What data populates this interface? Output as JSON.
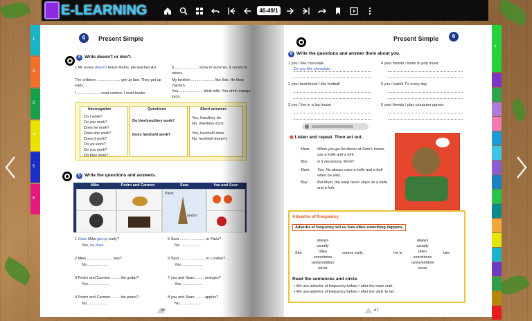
{
  "app": {
    "logo_text": "E-LEARNING",
    "page_indicator": "46-49/1"
  },
  "toolbar": {
    "icons": [
      "home-icon",
      "zoom-icon",
      "thumbnails-icon",
      "undo-icon",
      "first-page-icon",
      "prev-page-icon",
      "next-page-icon",
      "last-page-icon",
      "redo-icon",
      "bookmark-icon",
      "slideshow-icon",
      "more-icon"
    ]
  },
  "left": {
    "unit": "6",
    "title": "Present Simple",
    "ex4_num": "4",
    "ex4_title": "Write doesn't or don't.",
    "ex4_lines": [
      {
        "n": "1",
        "t": "Mr Jones ",
        "fill": "doesn't",
        "rest": " teach Maths. He teaches Art."
      },
      {
        "n": "2",
        "t": "The children ...................... get up late. They get up early.",
        "fill": "",
        "rest": ""
      },
      {
        "n": "3",
        "t": "I ...................... read comics. I read books.",
        "fill": "",
        "rest": ""
      },
      {
        "n": "4",
        "t": "It ...................... snow in summer. It snows in winter.",
        "fill": "",
        "rest": ""
      },
      {
        "n": "5",
        "t": "My brother ...................... like fish. He likes chicken.",
        "fill": "",
        "rest": ""
      },
      {
        "n": "6",
        "t": "You ...................... drink milk. You drink orange juice.",
        "fill": "",
        "rest": ""
      }
    ],
    "table": {
      "headers": [
        "Interrogative",
        "Questions",
        "Short answers"
      ],
      "interrogative": [
        "Do I work?",
        "Do you work?",
        "Does he work?",
        "Does she work?",
        "Does it work?",
        "Do we work?",
        "Do you work?",
        "Do they work?"
      ],
      "questions": [
        "Do I/we/you/they work?",
        "Does he/she/it work?"
      ],
      "answers": [
        "Yes, I/we/they do.",
        "No, I/we/they don't.",
        "Yes, he/she/it does.",
        "No, he/she/it doesn't."
      ]
    },
    "ex5_num": "5",
    "ex5_title": "Write the questions and answers.",
    "columns": [
      "Mike",
      "Pedro and Carmen",
      "Sara",
      "You and Sean"
    ],
    "places": [
      "Paris",
      "London"
    ],
    "ex5_lines": [
      {
        "n": "1",
        "a": "Does",
        "b": "Mike ",
        "c": "get up",
        "d": " early?",
        "e": "Yes, ",
        "f": "he does"
      },
      {
        "n": "2",
        "a": "",
        "b": "Mike ........................ late?",
        "c": "",
        "d": "",
        "e": "No, ..................",
        "f": ""
      },
      {
        "n": "3",
        "a": "",
        "b": "Pedro and Carmen ........ the guitar?",
        "c": "",
        "d": "",
        "e": "Yes, ..................",
        "f": ""
      },
      {
        "n": "4",
        "a": "",
        "b": "Pedro and Carmen ........ the piano?",
        "c": "",
        "d": "",
        "e": "No, ..................",
        "f": ""
      },
      {
        "n": "5",
        "a": "",
        "b": "Sara ........................ in Paris?",
        "c": "",
        "d": "",
        "e": "No, ..................",
        "f": ""
      },
      {
        "n": "6",
        "a": "",
        "b": "Sara ........................ in London?",
        "c": "",
        "d": "",
        "e": "Yes, ..................",
        "f": ""
      },
      {
        "n": "7",
        "a": "",
        "b": "you and Sean ........ oranges?",
        "c": "",
        "d": "",
        "e": "Yes, ..................",
        "f": ""
      },
      {
        "n": "8",
        "a": "",
        "b": "you and Sean ........ apples?",
        "c": "",
        "d": "",
        "e": "No, ..................",
        "f": ""
      }
    ],
    "page_number": "46"
  },
  "right": {
    "title": "Present Simple",
    "unit": "6",
    "ex_num": "6",
    "ex_title": "Write the questions and answer them about you.",
    "q_left": [
      {
        "n": "1",
        "t": "you / like chocolate",
        "fill": "Do you like chocolate"
      },
      {
        "n": "2",
        "t": "your best friend / like football",
        "fill": ""
      },
      {
        "n": "3",
        "t": "you / live in a big house",
        "fill": ""
      }
    ],
    "q_right": [
      {
        "n": "4",
        "t": "your friends / listen to pop music"
      },
      {
        "n": "5",
        "t": "you / watch TV every day"
      },
      {
        "n": "6",
        "t": "your friends / play computer games"
      }
    ],
    "listen_title": "Listen and repeat. Then act out.",
    "dialogue": [
      {
        "sp": "Mum:",
        "t": "When you go for dinner at Sam's house, use a knife and a fork."
      },
      {
        "sp": "Boy:",
        "t": "Is it necessary, Mum?"
      },
      {
        "sp": "Mum:",
        "t": "Yes. He always uses a knife and a fork when he eats."
      },
      {
        "sp": "Boy:",
        "t": "But Mum, the soup never stays on a knife and a fork."
      }
    ],
    "adverbs_title": "Adverbs of frequency",
    "adverbs_sub": "Adverbs of frequency tell us how often something happens.",
    "adverbs_list": [
      "always",
      "usually",
      "often",
      "sometimes",
      "rarely/seldom",
      "never"
    ],
    "she": "She",
    "comes_early": "comes early.",
    "he_is": "He is",
    "late": "late.",
    "read_title": "Read the sentences and circle.",
    "rules": [
      "We use adverbs of frequency before / after the main verb.",
      "We use adverbs of frequency before / after the verb 'to be'."
    ],
    "page_number": "47"
  },
  "left_tabs": [
    {
      "label": "1",
      "color": "#19b4c8"
    },
    {
      "label": "2",
      "color": "#f06f2a"
    },
    {
      "label": "3",
      "color": "#17a04a"
    },
    {
      "label": "4",
      "color": "#e9e300"
    },
    {
      "label": "5",
      "color": "#1b2fc7"
    },
    {
      "label": "6",
      "color": "#e5187c"
    }
  ],
  "right_tabs": [
    {
      "label": "7",
      "color": "#22d43a"
    },
    {
      "label": "",
      "color": "#7a35c9"
    },
    {
      "label": "",
      "color": "#2fa34d"
    },
    {
      "label": "",
      "color": "#b07ad8"
    },
    {
      "label": "",
      "color": "#f07cb1"
    },
    {
      "label": "",
      "color": "#1b9ad8"
    },
    {
      "label": "",
      "color": "#3ec4e6"
    },
    {
      "label": "",
      "color": "#8b5cd2"
    },
    {
      "label": "",
      "color": "#1e7fc0"
    },
    {
      "label": "",
      "color": "#25c44a"
    },
    {
      "label": "",
      "color": "#0b8b8b"
    },
    {
      "label": "",
      "color": "#f3a63a"
    },
    {
      "label": "",
      "color": "#e3e600"
    },
    {
      "label": "",
      "color": "#19b4c8"
    },
    {
      "label": "",
      "color": "#6c3bc4"
    },
    {
      "label": "",
      "color": "#2d9f49"
    },
    {
      "label": "",
      "color": "#b8860b"
    },
    {
      "label": "",
      "color": "#e81c1c"
    }
  ]
}
